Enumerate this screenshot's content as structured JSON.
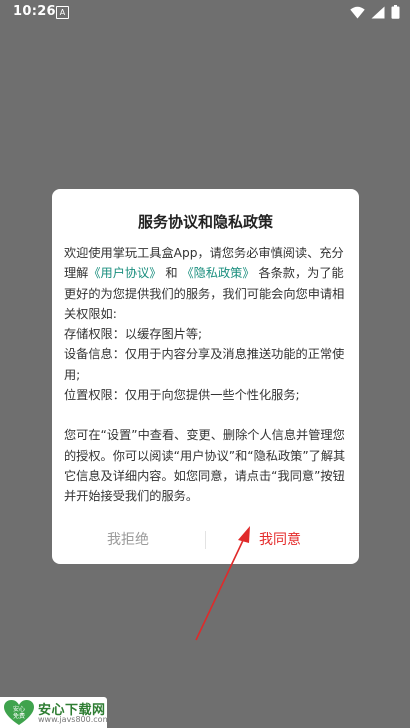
{
  "status_bar": {
    "time": "10:26",
    "notification_icon": "A",
    "icons": [
      "wifi-icon",
      "signal-icon",
      "battery-icon"
    ]
  },
  "dialog": {
    "title": "服务协议和隐私政策",
    "intro_before": "欢迎使用掌玩工具盒App，请您务必审慎阅读、充分理解",
    "user_agreement_link": "《用户协议》",
    "and": "和",
    "privacy_policy_link": "《隐私政策》",
    "intro_after": "各条款，为了能更好的为您提供我们的服务，我们可能会向您申请相关权限如:",
    "permissions": [
      "存储权限：以缓存图片等;",
      "设备信息：仅用于内容分享及消息推送功能的正常使用;",
      "位置权限：仅用于向您提供一些个性化服务;"
    ],
    "footer_text": "您可在“设置”中查看、变更、删除个人信息并管理您的授权。你可以阅读“用户协议”和“隐私政策”了解其它信息及详细内容。如您同意，请点击“我同意”按钮并开始接受我们的服务。",
    "decline_label": "我拒绝",
    "agree_label": "我同意"
  },
  "watermark": {
    "logo_text": "安心\n免费",
    "name": "安心下载网",
    "url": "www.javs800.com"
  },
  "colors": {
    "link": "#1a8e7e",
    "agree": "#e52b2b",
    "decline": "#9a9a9a",
    "arrow": "#e02a2a"
  }
}
